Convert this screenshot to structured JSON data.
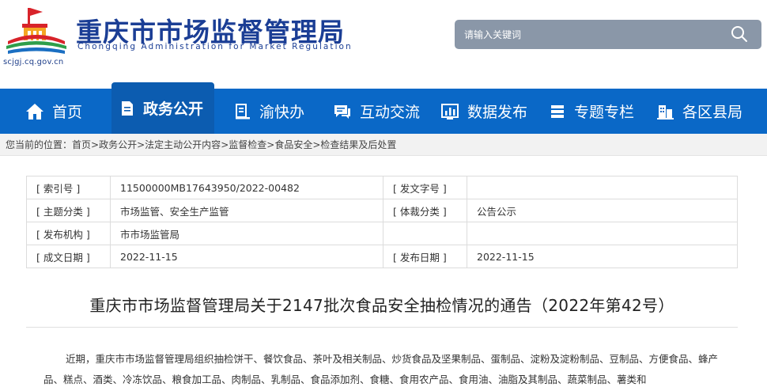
{
  "site": {
    "title": "重庆市市场监督管理局",
    "subtitle": "Chongqing Administration for Market Regulation",
    "url": "scjgj.cq.gov.cn"
  },
  "search": {
    "placeholder": "请输入关键词"
  },
  "nav": {
    "items": [
      {
        "label": "首页",
        "icon": "home-icon"
      },
      {
        "label": "政务公开",
        "icon": "document-icon",
        "active": true
      },
      {
        "label": "渝快办",
        "icon": "service-icon"
      },
      {
        "label": "互动交流",
        "icon": "chat-icon"
      },
      {
        "label": "数据发布",
        "icon": "chart-icon"
      },
      {
        "label": "专题专栏",
        "icon": "list-icon"
      },
      {
        "label": "各区县局",
        "icon": "building-icon"
      }
    ]
  },
  "breadcrumb": {
    "prefix": "您当前的位置：",
    "items": [
      "首页",
      "政务公开",
      "法定主动公开内容",
      "监督检查",
      "食品安全",
      "检查结果及后处置"
    ],
    "separator": ">"
  },
  "info": {
    "index_label": "[ 索引号 ]",
    "index_value": "11500000MB17643950/2022-00482",
    "doc_no_label": "[ 发文字号 ]",
    "doc_no_value": "",
    "topic_label": "[ 主题分类 ]",
    "topic_value": "市场监管、安全生产监管",
    "genre_label": "[ 体裁分类 ]",
    "genre_value": "公告公示",
    "issuer_label": "[ 发布机构 ]",
    "issuer_value": "市市场监管局",
    "created_label": "[ 成文日期 ]",
    "created_value": "2022-11-15",
    "published_label": "[ 发布日期 ]",
    "published_value": "2022-11-15"
  },
  "article": {
    "title": "重庆市市场监督管理局关于2147批次食品安全抽检情况的通告（2022年第42号）",
    "body": "近期，重庆市市场监督管理局组织抽检饼干、餐饮食品、茶叶及相关制品、炒货食品及坚果制品、蛋制品、淀粉及淀粉制品、豆制品、方便食品、蜂产品、糕点、酒类、冷冻饮品、粮食加工品、肉制品、乳制品、食品添加剂、食糖、食用农产品、食用油、油脂及其制品、蔬菜制品、薯类和"
  },
  "colors": {
    "brand_blue": "#1b3e95",
    "nav_blue": "#0a68c7",
    "nav_active": "#0c5cb0"
  }
}
